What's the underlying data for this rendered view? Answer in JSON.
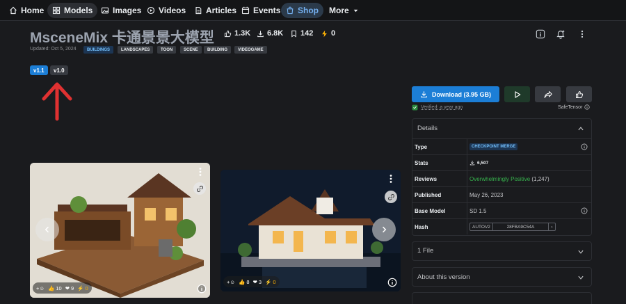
{
  "nav": {
    "items": [
      {
        "label": "Home",
        "icon": "home-icon"
      },
      {
        "label": "Models",
        "icon": "grid-icon"
      },
      {
        "label": "Images",
        "icon": "image-icon"
      },
      {
        "label": "Videos",
        "icon": "video-icon"
      },
      {
        "label": "Articles",
        "icon": "article-icon"
      },
      {
        "label": "Events",
        "icon": "calendar-icon"
      },
      {
        "label": "Shop",
        "icon": "shop-icon"
      },
      {
        "label": "More",
        "icon": "chevron-down-icon"
      }
    ]
  },
  "model": {
    "title": "MsceneMix 卡通景景大模型",
    "likes": "1.3K",
    "downloads": "6.8K",
    "collections": "142",
    "buzz": "0",
    "updated": "Updated: Oct 5, 2024",
    "tags": [
      "BUILDINGS",
      "LANDSCAPES",
      "TOON",
      "SCENE",
      "BUILDING",
      "VIDEOGAME"
    ],
    "versions": [
      "v1.1",
      "v1.0"
    ]
  },
  "actions": {
    "download_label": "Download (3.95 GB)",
    "verified": "Verified: a year ago",
    "safetensor": "SafeTensor"
  },
  "details": {
    "heading": "Details",
    "rows": {
      "type": {
        "label": "Type",
        "value": "CHECKPOINT MERGE"
      },
      "stats": {
        "label": "Stats",
        "value": "6,507"
      },
      "reviews": {
        "label": "Reviews",
        "value": "Overwhelmingly Positive",
        "count": "(1,247)"
      },
      "published": {
        "label": "Published",
        "value": "May 26, 2023"
      },
      "base": {
        "label": "Base Model",
        "value": "SD 1.5"
      },
      "hash": {
        "label": "Hash",
        "type": "AUTOV2",
        "value": "28FBA9C54A"
      }
    }
  },
  "files_panel": "1 File",
  "about_panel": "About this version",
  "gallery": [
    {
      "likes": "10",
      "hearts": "9",
      "buzz": "0"
    },
    {
      "likes": "8",
      "hearts": "3",
      "buzz": "0"
    }
  ],
  "colors": {
    "accent": "#1c7ed6",
    "background": "#1a1b1e",
    "arrow": "#e03131"
  }
}
